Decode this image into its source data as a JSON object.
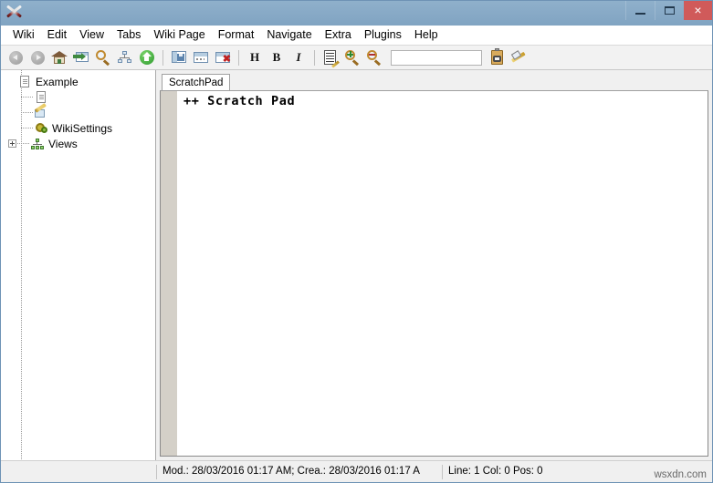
{
  "window": {
    "title": "",
    "app_icon": "crossed-pens-icon",
    "controls": {
      "minimize": "minimize-icon",
      "maximize": "maximize-icon",
      "close": "×",
      "close_color": "#d05a5a"
    },
    "titlebar_color": "#87a9c6"
  },
  "menubar": {
    "items": [
      {
        "label": "Wiki"
      },
      {
        "label": "Edit"
      },
      {
        "label": "View"
      },
      {
        "label": "Tabs"
      },
      {
        "label": "Wiki Page"
      },
      {
        "label": "Format"
      },
      {
        "label": "Navigate"
      },
      {
        "label": "Extra"
      },
      {
        "label": "Plugins"
      },
      {
        "label": "Help"
      }
    ]
  },
  "toolbar": {
    "heading_label": "H",
    "bold_label": "B",
    "italic_label": "I",
    "search": {
      "value": "",
      "placeholder": ""
    },
    "icons": [
      "back-icon",
      "forward-icon",
      "home-icon",
      "open-in-window-icon",
      "search-icon",
      "tree-view-icon",
      "up-arrow-icon",
      "save-page-icon",
      "rename-page-icon",
      "delete-page-icon",
      "document-list-icon",
      "zoom-in-icon",
      "zoom-out-icon",
      "clipboard-catcher-icon",
      "wand-icon"
    ]
  },
  "tree": {
    "items": [
      {
        "label": "Example",
        "icon": "page-icon",
        "level": 0,
        "expander": false
      },
      {
        "label": "",
        "icon": "page-icon",
        "level": 1,
        "expander": false
      },
      {
        "label": "",
        "icon": "scratchpad-icon",
        "level": 1,
        "expander": false
      },
      {
        "label": "WikiSettings",
        "icon": "gear-icon",
        "level": 1,
        "expander": false
      },
      {
        "label": "Views",
        "icon": "views-icon",
        "level": 1,
        "expander": true
      }
    ]
  },
  "editor": {
    "tabs": [
      {
        "label": "ScratchPad",
        "active": true
      }
    ],
    "content": "++ Scratch Pad"
  },
  "statusbar": {
    "modified_created": "Mod.: 28/03/2016 01:17 AM; Crea.: 28/03/2016 01:17 A",
    "cursor_position": "Line: 1 Col: 0 Pos: 0"
  },
  "watermark": {
    "text": "wsxdn.com"
  }
}
